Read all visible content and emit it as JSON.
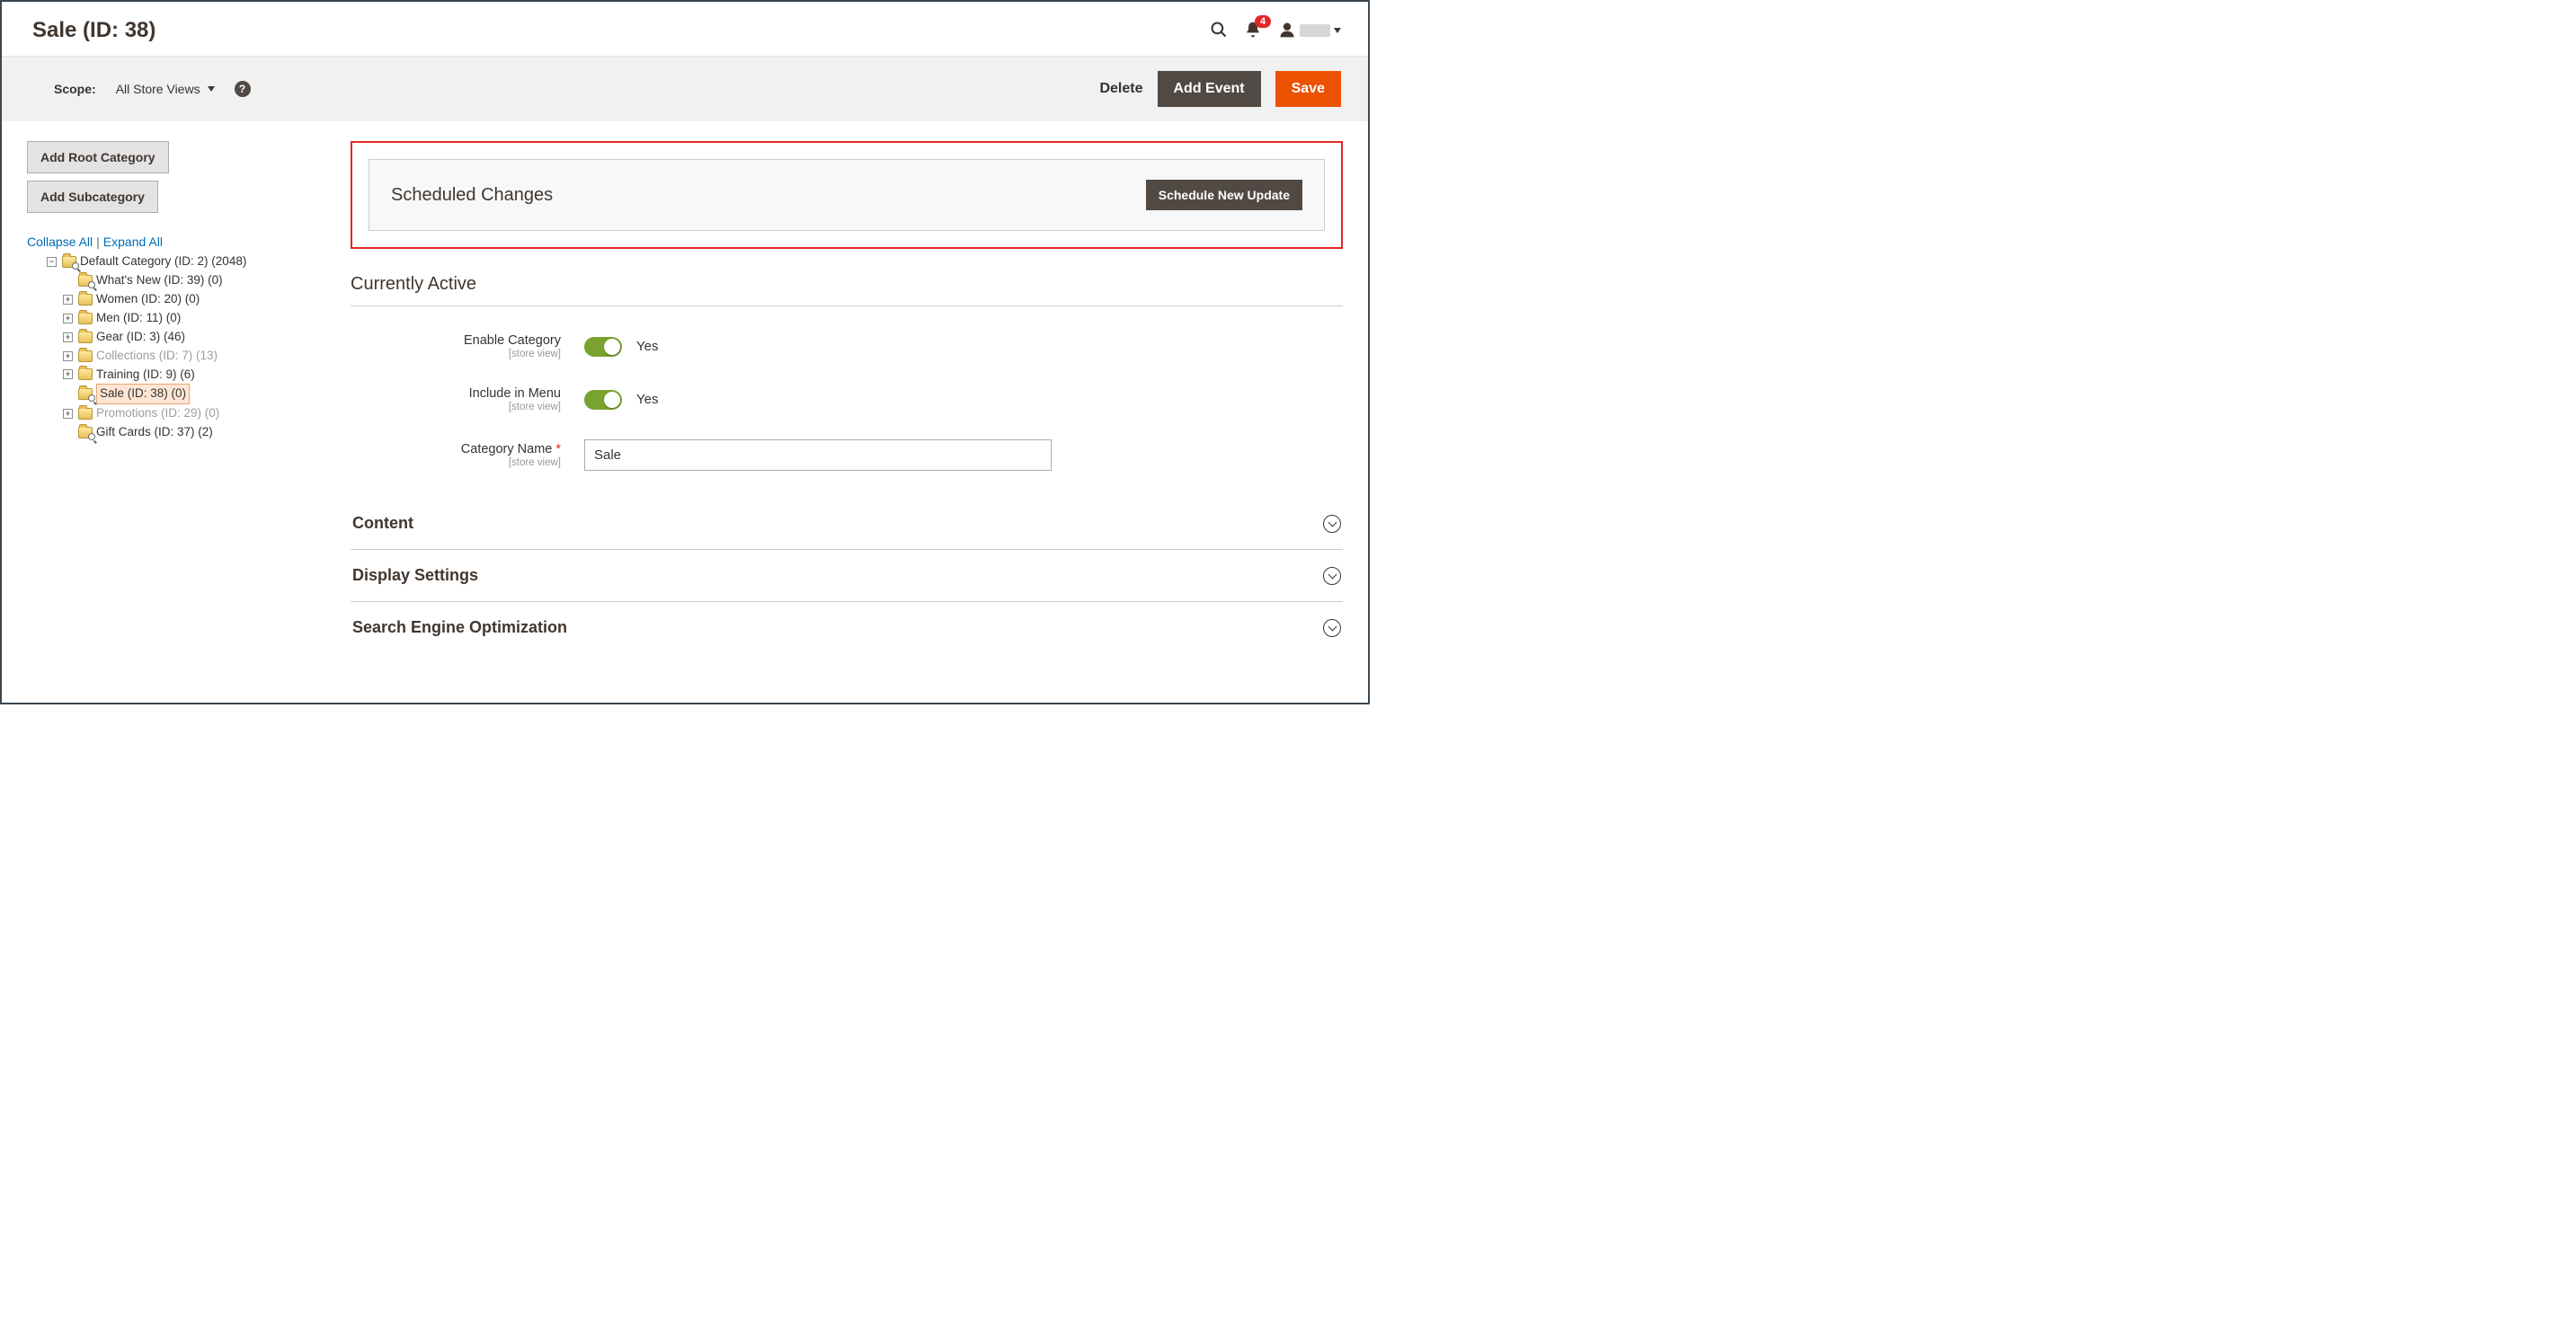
{
  "header": {
    "title": "Sale (ID: 38)",
    "notification_count": "4"
  },
  "toolbar": {
    "scope_label": "Scope:",
    "scope_value": "All Store Views",
    "delete": "Delete",
    "add_event": "Add Event",
    "save": "Save"
  },
  "sidebar": {
    "add_root": "Add Root Category",
    "add_sub": "Add Subcategory",
    "collapse_all": "Collapse All",
    "expand_all": "Expand All",
    "tree": [
      {
        "indent": 0,
        "pm": "minus",
        "mag": true,
        "label": "Default Category (ID: 2) (2048)",
        "muted": false,
        "selected": false
      },
      {
        "indent": 1,
        "pm": "none",
        "mag": true,
        "label": "What's New (ID: 39) (0)",
        "muted": false,
        "selected": false
      },
      {
        "indent": 1,
        "pm": "plus",
        "mag": false,
        "label": "Women (ID: 20) (0)",
        "muted": false,
        "selected": false
      },
      {
        "indent": 1,
        "pm": "plus",
        "mag": false,
        "label": "Men (ID: 11) (0)",
        "muted": false,
        "selected": false
      },
      {
        "indent": 1,
        "pm": "plus",
        "mag": false,
        "label": "Gear (ID: 3) (46)",
        "muted": false,
        "selected": false
      },
      {
        "indent": 1,
        "pm": "plus",
        "mag": false,
        "label": "Collections (ID: 7) (13)",
        "muted": true,
        "selected": false
      },
      {
        "indent": 1,
        "pm": "plus",
        "mag": false,
        "label": "Training (ID: 9) (6)",
        "muted": false,
        "selected": false
      },
      {
        "indent": 1,
        "pm": "none",
        "mag": true,
        "label": "Sale (ID: 38) (0)",
        "muted": false,
        "selected": true
      },
      {
        "indent": 1,
        "pm": "plus",
        "mag": false,
        "label": "Promotions (ID: 29) (0)",
        "muted": true,
        "selected": false
      },
      {
        "indent": 1,
        "pm": "none",
        "mag": true,
        "label": "Gift Cards (ID: 37) (2)",
        "muted": false,
        "selected": false
      }
    ]
  },
  "scheduled": {
    "title": "Scheduled Changes",
    "button": "Schedule New Update"
  },
  "active": {
    "title": "Currently Active",
    "scope_note": "[store view]",
    "enable_label": "Enable Category",
    "enable_value": "Yes",
    "include_label": "Include in Menu",
    "include_value": "Yes",
    "name_label": "Category Name",
    "name_value": "Sale"
  },
  "sections": [
    {
      "label": "Content"
    },
    {
      "label": "Display Settings"
    },
    {
      "label": "Search Engine Optimization"
    }
  ]
}
